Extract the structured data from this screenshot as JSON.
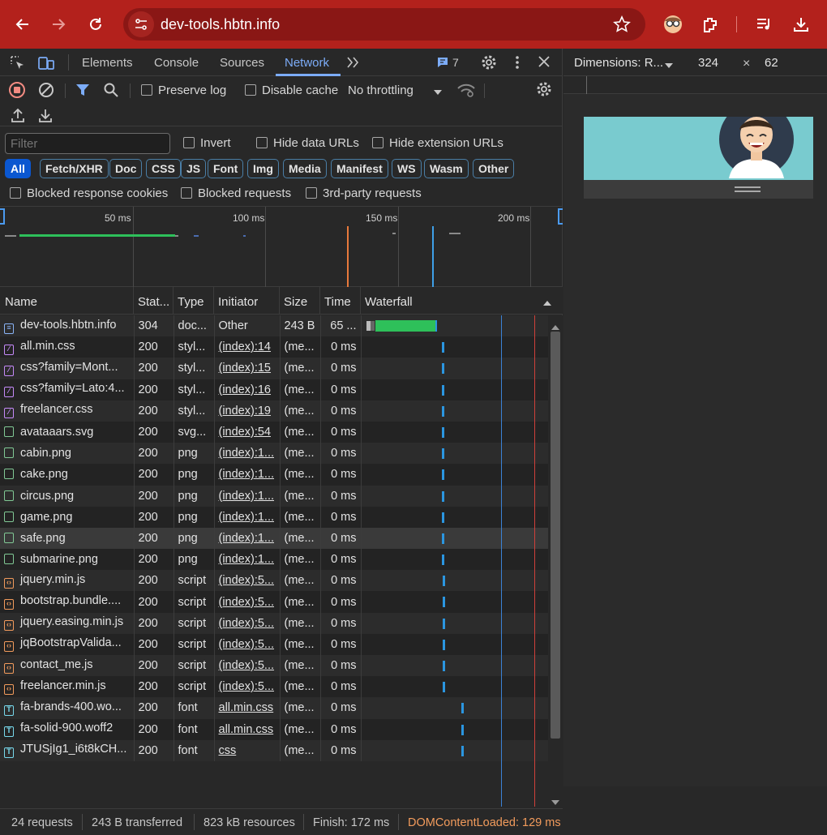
{
  "browser": {
    "url": "dev-tools.hbtn.info",
    "colors": {
      "bar": "#b3211c"
    }
  },
  "devtools": {
    "tabs": [
      "Elements",
      "Console",
      "Sources",
      "Network"
    ],
    "active_tab": "Network",
    "issues_count": "7",
    "toolbar": {
      "preserve_log": "Preserve log",
      "disable_cache": "Disable cache",
      "throttling": "No throttling"
    },
    "filter": {
      "placeholder": "Filter",
      "invert": "Invert",
      "hide_data_urls": "Hide data URLs",
      "hide_extension_urls": "Hide extension URLs",
      "types": [
        "All",
        "Fetch/XHR",
        "Doc",
        "CSS",
        "JS",
        "Font",
        "Img",
        "Media",
        "Manifest",
        "WS",
        "Wasm",
        "Other"
      ],
      "blocked_cookies": "Blocked response cookies",
      "blocked_requests": "Blocked requests",
      "third_party": "3rd-party requests"
    },
    "overview_ticks": [
      "50 ms",
      "100 ms",
      "150 ms",
      "200 ms"
    ],
    "columns": {
      "name": "Name",
      "status": "Stat...",
      "type": "Type",
      "initiator": "Initiator",
      "size": "Size",
      "time": "Time",
      "waterfall": "Waterfall"
    },
    "requests": [
      {
        "name": "dev-tools.hbtn.info",
        "status": "304",
        "type": "doc...",
        "initiator": "Other",
        "size": "243 B",
        "time": "65 ...",
        "kind": "doc"
      },
      {
        "name": "all.min.css",
        "status": "200",
        "type": "styl...",
        "initiator": "(index):14",
        "size": "(me...",
        "time": "0 ms",
        "kind": "css"
      },
      {
        "name": "css?family=Mont...",
        "status": "200",
        "type": "styl...",
        "initiator": "(index):15",
        "size": "(me...",
        "time": "0 ms",
        "kind": "css"
      },
      {
        "name": "css?family=Lato:4...",
        "status": "200",
        "type": "styl...",
        "initiator": "(index):16",
        "size": "(me...",
        "time": "0 ms",
        "kind": "css"
      },
      {
        "name": "freelancer.css",
        "status": "200",
        "type": "styl...",
        "initiator": "(index):19",
        "size": "(me...",
        "time": "0 ms",
        "kind": "css"
      },
      {
        "name": "avataaars.svg",
        "status": "200",
        "type": "svg...",
        "initiator": "(index):54",
        "size": "(me...",
        "time": "0 ms",
        "kind": "img"
      },
      {
        "name": "cabin.png",
        "status": "200",
        "type": "png",
        "initiator": "(index):1...",
        "size": "(me...",
        "time": "0 ms",
        "kind": "img"
      },
      {
        "name": "cake.png",
        "status": "200",
        "type": "png",
        "initiator": "(index):1...",
        "size": "(me...",
        "time": "0 ms",
        "kind": "img"
      },
      {
        "name": "circus.png",
        "status": "200",
        "type": "png",
        "initiator": "(index):1...",
        "size": "(me...",
        "time": "0 ms",
        "kind": "img"
      },
      {
        "name": "game.png",
        "status": "200",
        "type": "png",
        "initiator": "(index):1...",
        "size": "(me...",
        "time": "0 ms",
        "kind": "img"
      },
      {
        "name": "safe.png",
        "status": "200",
        "type": "png",
        "initiator": "(index):1...",
        "size": "(me...",
        "time": "0 ms",
        "kind": "img"
      },
      {
        "name": "submarine.png",
        "status": "200",
        "type": "png",
        "initiator": "(index):1...",
        "size": "(me...",
        "time": "0 ms",
        "kind": "img"
      },
      {
        "name": "jquery.min.js",
        "status": "200",
        "type": "script",
        "initiator": "(index):5...",
        "size": "(me...",
        "time": "0 ms",
        "kind": "js"
      },
      {
        "name": "bootstrap.bundle....",
        "status": "200",
        "type": "script",
        "initiator": "(index):5...",
        "size": "(me...",
        "time": "0 ms",
        "kind": "js"
      },
      {
        "name": "jquery.easing.min.js",
        "status": "200",
        "type": "script",
        "initiator": "(index):5...",
        "size": "(me...",
        "time": "0 ms",
        "kind": "js"
      },
      {
        "name": "jqBootstrapValida...",
        "status": "200",
        "type": "script",
        "initiator": "(index):5...",
        "size": "(me...",
        "time": "0 ms",
        "kind": "js"
      },
      {
        "name": "contact_me.js",
        "status": "200",
        "type": "script",
        "initiator": "(index):5...",
        "size": "(me...",
        "time": "0 ms",
        "kind": "js"
      },
      {
        "name": "freelancer.min.js",
        "status": "200",
        "type": "script",
        "initiator": "(index):5...",
        "size": "(me...",
        "time": "0 ms",
        "kind": "js"
      },
      {
        "name": "fa-brands-400.wo...",
        "status": "200",
        "type": "font",
        "initiator": "all.min.css",
        "size": "(me...",
        "time": "0 ms",
        "kind": "font"
      },
      {
        "name": "fa-solid-900.woff2",
        "status": "200",
        "type": "font",
        "initiator": "all.min.css",
        "size": "(me...",
        "time": "0 ms",
        "kind": "font"
      },
      {
        "name": "JTUSjIg1_i6t8kCH...",
        "status": "200",
        "type": "font",
        "initiator": "css",
        "size": "(me...",
        "time": "0 ms",
        "kind": "font"
      }
    ],
    "status": {
      "requests": "24 requests",
      "transferred": "243 B transferred",
      "resources": "823 kB resources",
      "finish": "Finish: 172 ms",
      "dcl": "DOMContentLoaded: 129 ms"
    }
  },
  "viewport": {
    "dimensions_label": "Dimensions: R...",
    "width": "324",
    "times": "×",
    "height": "62"
  }
}
